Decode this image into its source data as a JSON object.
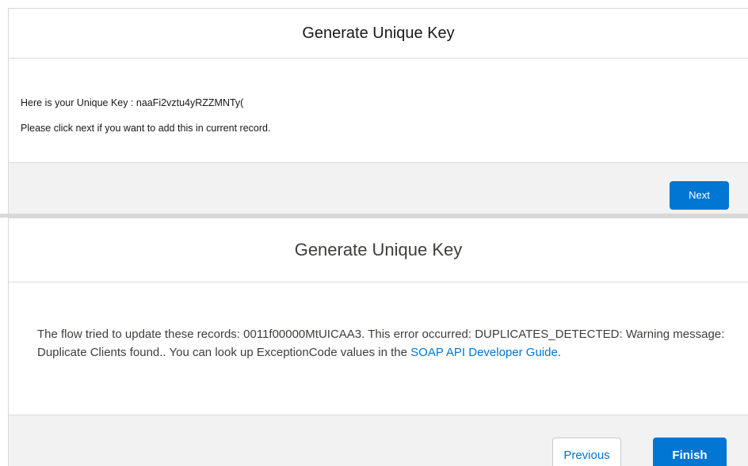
{
  "screen1": {
    "title": "Generate Unique Key",
    "line1": "Here is your Unique Key : naaFi2vztu4yRZZMNTy(",
    "line2": "Please click next if you want to add this in current record.",
    "next_label": "Next"
  },
  "screen2": {
    "title": "Generate Unique Key",
    "error_text": "The flow tried to update these records: 0011f00000MtUICAA3. This error occurred: DUPLICATES_DETECTED: Warning message: Duplicate Clients found.. You can look up ExceptionCode values in the ",
    "link_text": "SOAP API Developer Guide",
    "error_suffix": ".",
    "previous_label": "Previous",
    "finish_label": "Finish"
  },
  "colors": {
    "brand": "#0176d3",
    "footer_bg": "#f3f2f2",
    "border": "#d8d8d8"
  }
}
